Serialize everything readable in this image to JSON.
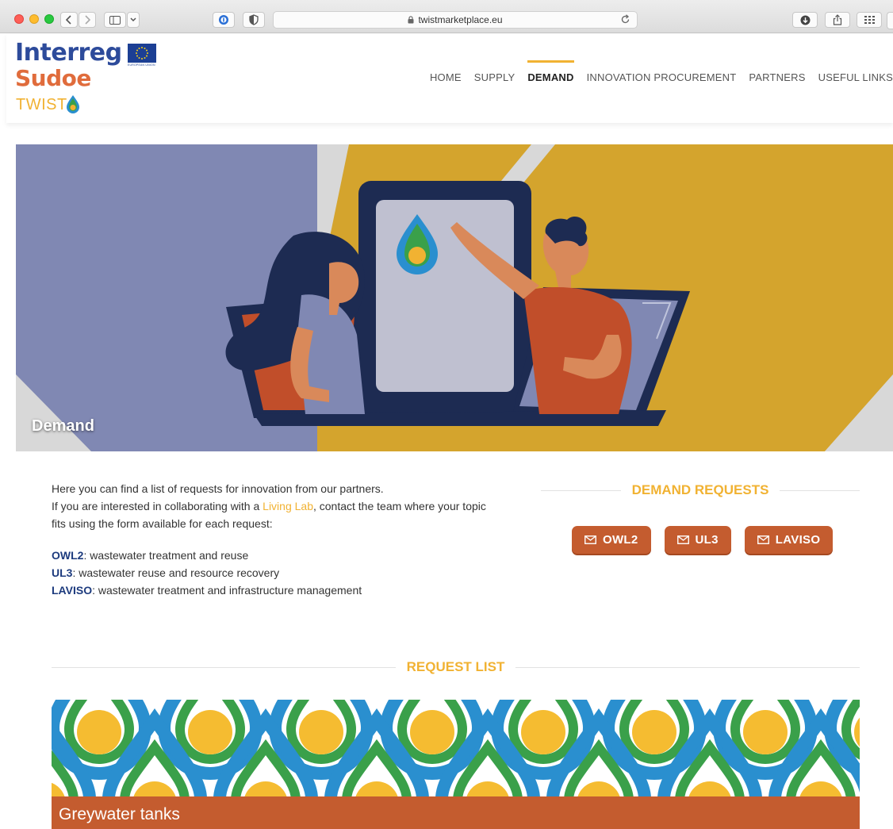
{
  "browser": {
    "url": "twistmarketplace.eu"
  },
  "logo": {
    "interreg": "Interreg",
    "sudoe": "Sudoe",
    "twist": "TWIST",
    "eu_caption": "EUROPEAN UNION"
  },
  "nav": {
    "items": [
      {
        "label": "HOME",
        "active": false
      },
      {
        "label": "SUPPLY",
        "active": false
      },
      {
        "label": "DEMAND",
        "active": true
      },
      {
        "label": "INNOVATION PROCUREMENT",
        "active": false
      },
      {
        "label": "PARTNERS",
        "active": false
      },
      {
        "label": "USEFUL LINKS",
        "active": false
      }
    ]
  },
  "hero": {
    "title": "Demand"
  },
  "intro": {
    "line1": "Here you can find a list of requests for innovation from our partners.",
    "line2_pre": "If you are interested in collaborating with a ",
    "line2_link": "Living Lab",
    "line2_post": ", contact the team where your topic fits using the form available for each request:",
    "labs": [
      {
        "name": "OWL2",
        "desc": ": wastewater treatment and reuse"
      },
      {
        "name": "UL3",
        "desc": ": wastewater reuse and resource recovery"
      },
      {
        "name": "LAVISO",
        "desc": ": wastewater treatment and infrastructure management"
      }
    ]
  },
  "demand_requests": {
    "heading": "DEMAND REQUESTS",
    "buttons": [
      "OWL2",
      "UL3",
      "LAVISO"
    ]
  },
  "request_list": {
    "heading": "REQUEST LIST",
    "first_card_title": "Greywater tanks"
  },
  "colors": {
    "accent_yellow": "#f1b232",
    "accent_orange": "#c45c2f",
    "navy": "#1d3b7e"
  }
}
